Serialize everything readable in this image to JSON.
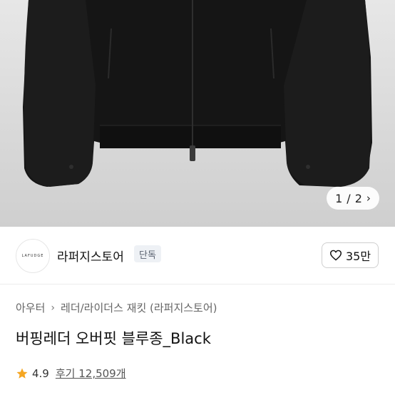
{
  "product_image": {
    "pager_current": "1",
    "pager_separator": "/",
    "pager_total": "2"
  },
  "store": {
    "logo_text": "LAFUDGE",
    "name": "라퍼지스토어",
    "tag": "단독",
    "like_count": "35만"
  },
  "breadcrumb": {
    "level1": "아우터",
    "level2": "레더/라이더스 재킷 (라퍼지스토어)"
  },
  "product": {
    "title": "버핑레더 오버핏 블루종_Black",
    "rating": "4.9",
    "reviews": "후기 12,509개"
  },
  "colors": {
    "star": "#f5a623",
    "tag_bg": "#eef1f5"
  }
}
